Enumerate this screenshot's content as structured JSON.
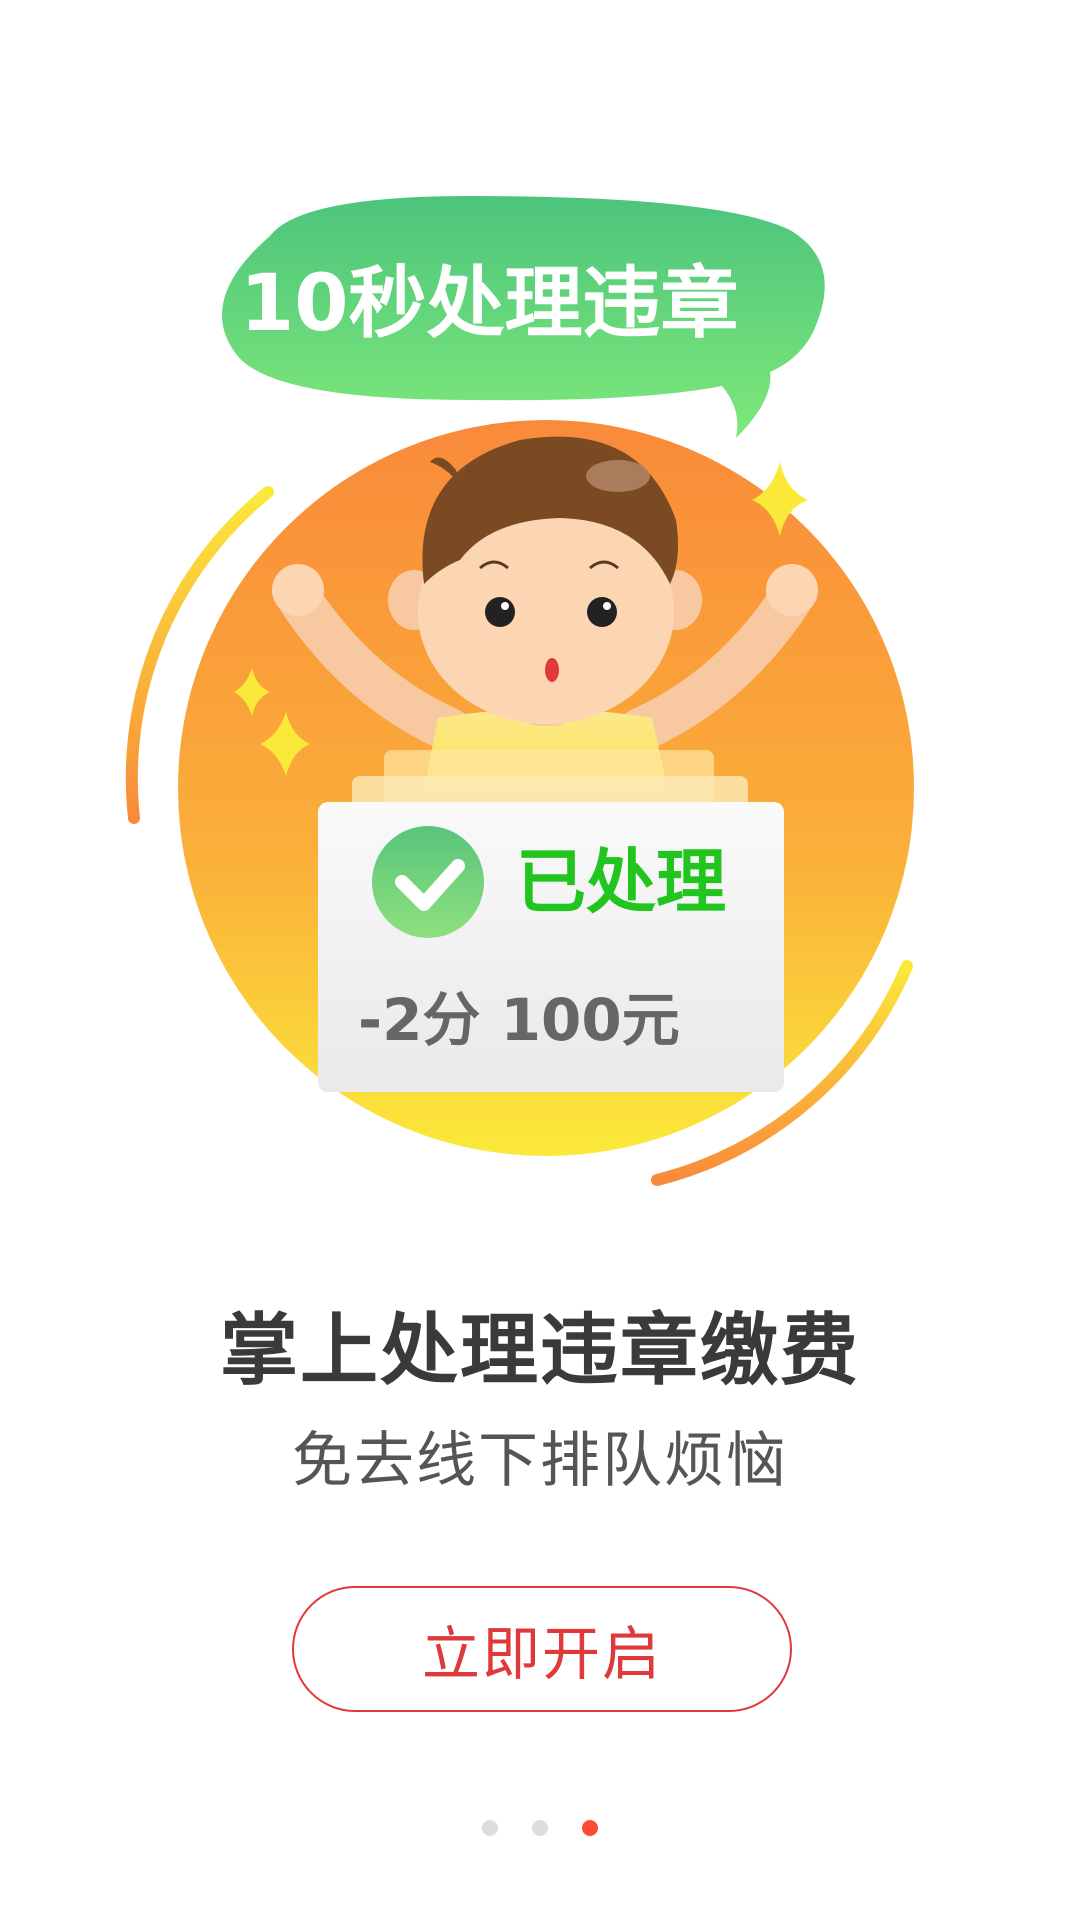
{
  "illustration": {
    "bubble_text": "10秒处理违章",
    "card_status": "已处理",
    "card_detail": "-2分 100元",
    "colors": {
      "bubble_top": "#4cc47c",
      "bubble_bottom": "#7ee87a",
      "circle_top": "#f98a3a",
      "circle_bottom": "#fbe93a",
      "status_green": "#22c41e",
      "detail_gray": "#666666"
    }
  },
  "headline": "掌上处理违章缴费",
  "subline": "免去线下排队烦恼",
  "cta": {
    "label": "立即开启",
    "color": "#e0393b"
  },
  "pager": {
    "count": 3,
    "active_index": 2,
    "active_color": "#ff4a36",
    "inactive_color": "#dddddd"
  }
}
